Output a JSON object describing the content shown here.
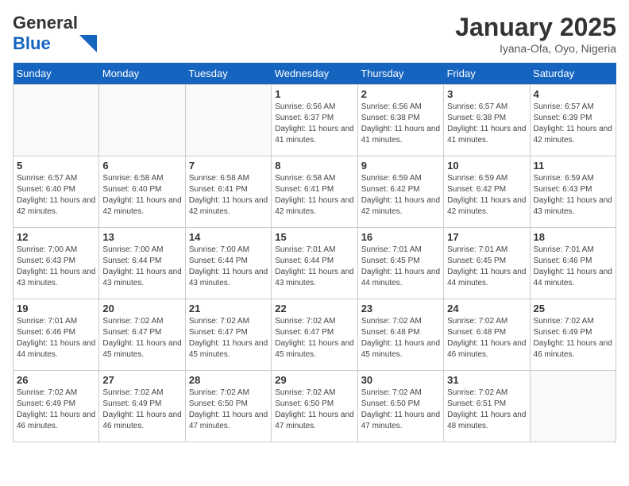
{
  "header": {
    "logo_general": "General",
    "logo_blue": "Blue",
    "month_title": "January 2025",
    "location": "Iyana-Ofa, Oyo, Nigeria"
  },
  "weekdays": [
    "Sunday",
    "Monday",
    "Tuesday",
    "Wednesday",
    "Thursday",
    "Friday",
    "Saturday"
  ],
  "weeks": [
    [
      {
        "day": "",
        "sunrise": "",
        "sunset": "",
        "daylight": ""
      },
      {
        "day": "",
        "sunrise": "",
        "sunset": "",
        "daylight": ""
      },
      {
        "day": "",
        "sunrise": "",
        "sunset": "",
        "daylight": ""
      },
      {
        "day": "1",
        "sunrise": "Sunrise: 6:56 AM",
        "sunset": "Sunset: 6:37 PM",
        "daylight": "Daylight: 11 hours and 41 minutes."
      },
      {
        "day": "2",
        "sunrise": "Sunrise: 6:56 AM",
        "sunset": "Sunset: 6:38 PM",
        "daylight": "Daylight: 11 hours and 41 minutes."
      },
      {
        "day": "3",
        "sunrise": "Sunrise: 6:57 AM",
        "sunset": "Sunset: 6:38 PM",
        "daylight": "Daylight: 11 hours and 41 minutes."
      },
      {
        "day": "4",
        "sunrise": "Sunrise: 6:57 AM",
        "sunset": "Sunset: 6:39 PM",
        "daylight": "Daylight: 11 hours and 42 minutes."
      }
    ],
    [
      {
        "day": "5",
        "sunrise": "Sunrise: 6:57 AM",
        "sunset": "Sunset: 6:40 PM",
        "daylight": "Daylight: 11 hours and 42 minutes."
      },
      {
        "day": "6",
        "sunrise": "Sunrise: 6:58 AM",
        "sunset": "Sunset: 6:40 PM",
        "daylight": "Daylight: 11 hours and 42 minutes."
      },
      {
        "day": "7",
        "sunrise": "Sunrise: 6:58 AM",
        "sunset": "Sunset: 6:41 PM",
        "daylight": "Daylight: 11 hours and 42 minutes."
      },
      {
        "day": "8",
        "sunrise": "Sunrise: 6:58 AM",
        "sunset": "Sunset: 6:41 PM",
        "daylight": "Daylight: 11 hours and 42 minutes."
      },
      {
        "day": "9",
        "sunrise": "Sunrise: 6:59 AM",
        "sunset": "Sunset: 6:42 PM",
        "daylight": "Daylight: 11 hours and 42 minutes."
      },
      {
        "day": "10",
        "sunrise": "Sunrise: 6:59 AM",
        "sunset": "Sunset: 6:42 PM",
        "daylight": "Daylight: 11 hours and 42 minutes."
      },
      {
        "day": "11",
        "sunrise": "Sunrise: 6:59 AM",
        "sunset": "Sunset: 6:43 PM",
        "daylight": "Daylight: 11 hours and 43 minutes."
      }
    ],
    [
      {
        "day": "12",
        "sunrise": "Sunrise: 7:00 AM",
        "sunset": "Sunset: 6:43 PM",
        "daylight": "Daylight: 11 hours and 43 minutes."
      },
      {
        "day": "13",
        "sunrise": "Sunrise: 7:00 AM",
        "sunset": "Sunset: 6:44 PM",
        "daylight": "Daylight: 11 hours and 43 minutes."
      },
      {
        "day": "14",
        "sunrise": "Sunrise: 7:00 AM",
        "sunset": "Sunset: 6:44 PM",
        "daylight": "Daylight: 11 hours and 43 minutes."
      },
      {
        "day": "15",
        "sunrise": "Sunrise: 7:01 AM",
        "sunset": "Sunset: 6:44 PM",
        "daylight": "Daylight: 11 hours and 43 minutes."
      },
      {
        "day": "16",
        "sunrise": "Sunrise: 7:01 AM",
        "sunset": "Sunset: 6:45 PM",
        "daylight": "Daylight: 11 hours and 44 minutes."
      },
      {
        "day": "17",
        "sunrise": "Sunrise: 7:01 AM",
        "sunset": "Sunset: 6:45 PM",
        "daylight": "Daylight: 11 hours and 44 minutes."
      },
      {
        "day": "18",
        "sunrise": "Sunrise: 7:01 AM",
        "sunset": "Sunset: 6:46 PM",
        "daylight": "Daylight: 11 hours and 44 minutes."
      }
    ],
    [
      {
        "day": "19",
        "sunrise": "Sunrise: 7:01 AM",
        "sunset": "Sunset: 6:46 PM",
        "daylight": "Daylight: 11 hours and 44 minutes."
      },
      {
        "day": "20",
        "sunrise": "Sunrise: 7:02 AM",
        "sunset": "Sunset: 6:47 PM",
        "daylight": "Daylight: 11 hours and 45 minutes."
      },
      {
        "day": "21",
        "sunrise": "Sunrise: 7:02 AM",
        "sunset": "Sunset: 6:47 PM",
        "daylight": "Daylight: 11 hours and 45 minutes."
      },
      {
        "day": "22",
        "sunrise": "Sunrise: 7:02 AM",
        "sunset": "Sunset: 6:47 PM",
        "daylight": "Daylight: 11 hours and 45 minutes."
      },
      {
        "day": "23",
        "sunrise": "Sunrise: 7:02 AM",
        "sunset": "Sunset: 6:48 PM",
        "daylight": "Daylight: 11 hours and 45 minutes."
      },
      {
        "day": "24",
        "sunrise": "Sunrise: 7:02 AM",
        "sunset": "Sunset: 6:48 PM",
        "daylight": "Daylight: 11 hours and 46 minutes."
      },
      {
        "day": "25",
        "sunrise": "Sunrise: 7:02 AM",
        "sunset": "Sunset: 6:49 PM",
        "daylight": "Daylight: 11 hours and 46 minutes."
      }
    ],
    [
      {
        "day": "26",
        "sunrise": "Sunrise: 7:02 AM",
        "sunset": "Sunset: 6:49 PM",
        "daylight": "Daylight: 11 hours and 46 minutes."
      },
      {
        "day": "27",
        "sunrise": "Sunrise: 7:02 AM",
        "sunset": "Sunset: 6:49 PM",
        "daylight": "Daylight: 11 hours and 46 minutes."
      },
      {
        "day": "28",
        "sunrise": "Sunrise: 7:02 AM",
        "sunset": "Sunset: 6:50 PM",
        "daylight": "Daylight: 11 hours and 47 minutes."
      },
      {
        "day": "29",
        "sunrise": "Sunrise: 7:02 AM",
        "sunset": "Sunset: 6:50 PM",
        "daylight": "Daylight: 11 hours and 47 minutes."
      },
      {
        "day": "30",
        "sunrise": "Sunrise: 7:02 AM",
        "sunset": "Sunset: 6:50 PM",
        "daylight": "Daylight: 11 hours and 47 minutes."
      },
      {
        "day": "31",
        "sunrise": "Sunrise: 7:02 AM",
        "sunset": "Sunset: 6:51 PM",
        "daylight": "Daylight: 11 hours and 48 minutes."
      },
      {
        "day": "",
        "sunrise": "",
        "sunset": "",
        "daylight": ""
      }
    ]
  ]
}
